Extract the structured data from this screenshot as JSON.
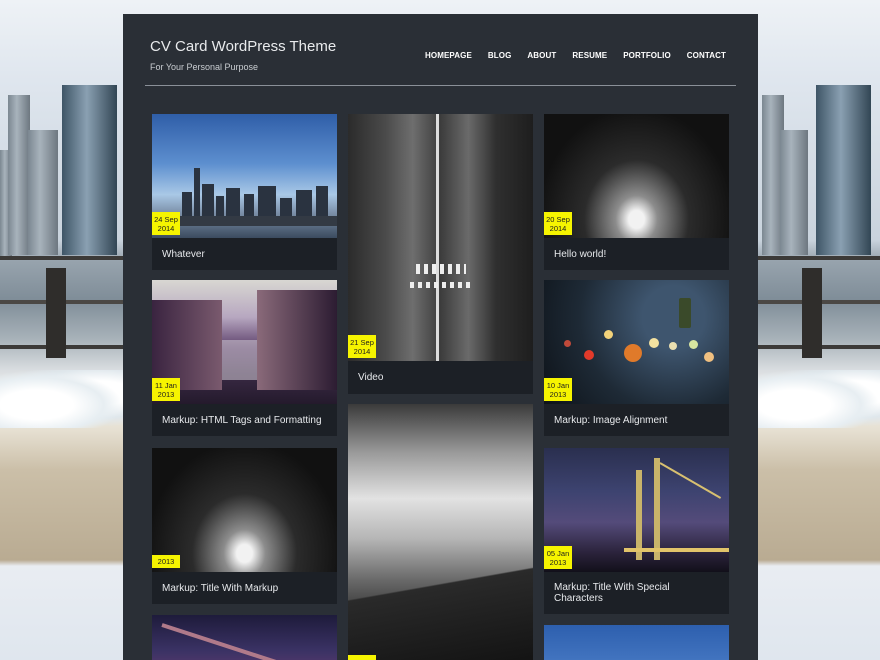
{
  "site": {
    "title": "CV Card WordPress Theme",
    "tagline": "For Your Personal Purpose"
  },
  "nav": [
    "HOMEPAGE",
    "BLOG",
    "ABOUT",
    "RESUME",
    "PORTFOLIO",
    "CONTACT"
  ],
  "posts": [
    {
      "title": "Whatever",
      "date_day": "24 Sep",
      "date_year": "2014"
    },
    {
      "title": "Video",
      "date_day": "21 Sep",
      "date_year": "2014"
    },
    {
      "title": "Hello world!",
      "date_day": "20 Sep",
      "date_year": "2014"
    },
    {
      "title": "Markup: HTML Tags and Formatting",
      "date_day": "11 Jan",
      "date_year": "2013"
    },
    {
      "title": "Markup: Image Alignment",
      "date_day": "10 Jan",
      "date_year": "2013"
    },
    {
      "title": "Markup: Title With Markup",
      "date_day": "",
      "date_year": "2013"
    },
    {
      "title": "Markup: Title With Special Characters",
      "date_day": "05 Jan",
      "date_year": "2013"
    }
  ],
  "colors": {
    "panel": "#2a2f36",
    "card": "#1c2026",
    "date_badge": "#f6f400"
  }
}
